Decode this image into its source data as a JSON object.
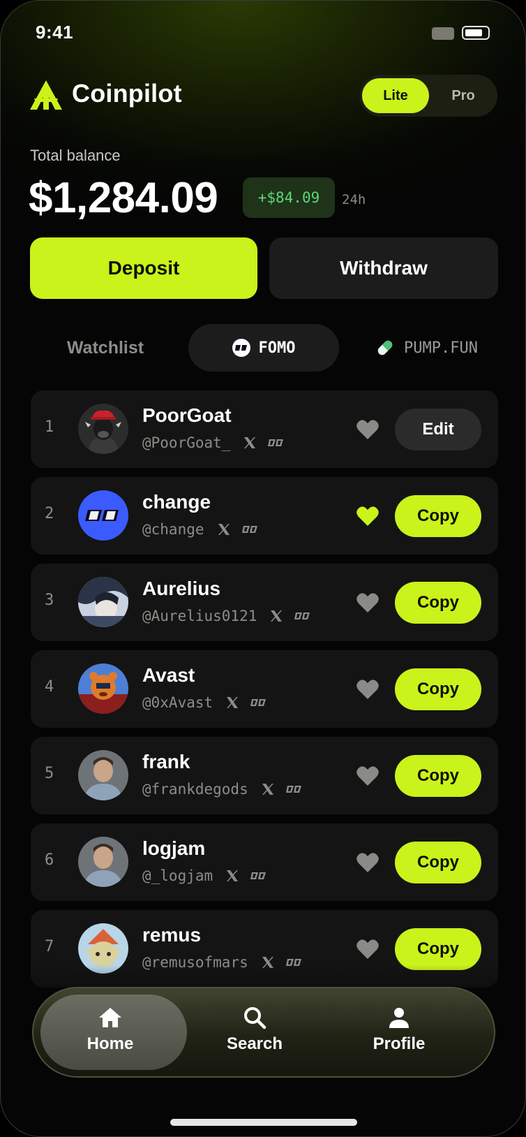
{
  "status_bar": {
    "time": "9:41"
  },
  "brand": {
    "name": "Coinpilot"
  },
  "mode_toggle": {
    "options": [
      "Lite",
      "Pro"
    ],
    "selected": "Lite"
  },
  "balance": {
    "label": "Total balance",
    "value": "$1,284.09",
    "change": "+$84.09",
    "period": "24h"
  },
  "actions": {
    "deposit": "Deposit",
    "withdraw": "Withdraw"
  },
  "tabs": [
    {
      "label": "Watchlist",
      "icon": "none"
    },
    {
      "label": "FOMO",
      "icon": "fomo-icon",
      "selected": true
    },
    {
      "label": "PUMP.FUN",
      "icon": "pill-icon"
    }
  ],
  "traders": [
    {
      "rank": "1",
      "name": "PoorGoat",
      "handle": "@PoorGoat_",
      "favorited": false,
      "button": "Edit",
      "avatar": "goat-avatar"
    },
    {
      "rank": "2",
      "name": "change",
      "handle": "@change",
      "favorited": true,
      "button": "Copy",
      "avatar": "change-avatar"
    },
    {
      "rank": "3",
      "name": "Aurelius",
      "handle": "@Aurelius0121",
      "favorited": false,
      "button": "Copy",
      "avatar": "anime-avatar"
    },
    {
      "rank": "4",
      "name": "Avast",
      "handle": "@0xAvast",
      "favorited": false,
      "button": "Copy",
      "avatar": "bear-avatar"
    },
    {
      "rank": "5",
      "name": "frank",
      "handle": "@frankdegods",
      "favorited": false,
      "button": "Copy",
      "avatar": "photo-avatar"
    },
    {
      "rank": "6",
      "name": "logjam",
      "handle": "@_logjam",
      "favorited": false,
      "button": "Copy",
      "avatar": "photo-avatar"
    },
    {
      "rank": "7",
      "name": "remus",
      "handle": "@remusofmars",
      "favorited": false,
      "button": "Copy",
      "avatar": "elf-avatar"
    }
  ],
  "nav": {
    "home": "Home",
    "search": "Search",
    "profile": "Profile",
    "selected": "Home"
  },
  "colors": {
    "accent": "#caf21b",
    "background": "#050505",
    "card": "#141414",
    "positive": "#5dd87a"
  }
}
